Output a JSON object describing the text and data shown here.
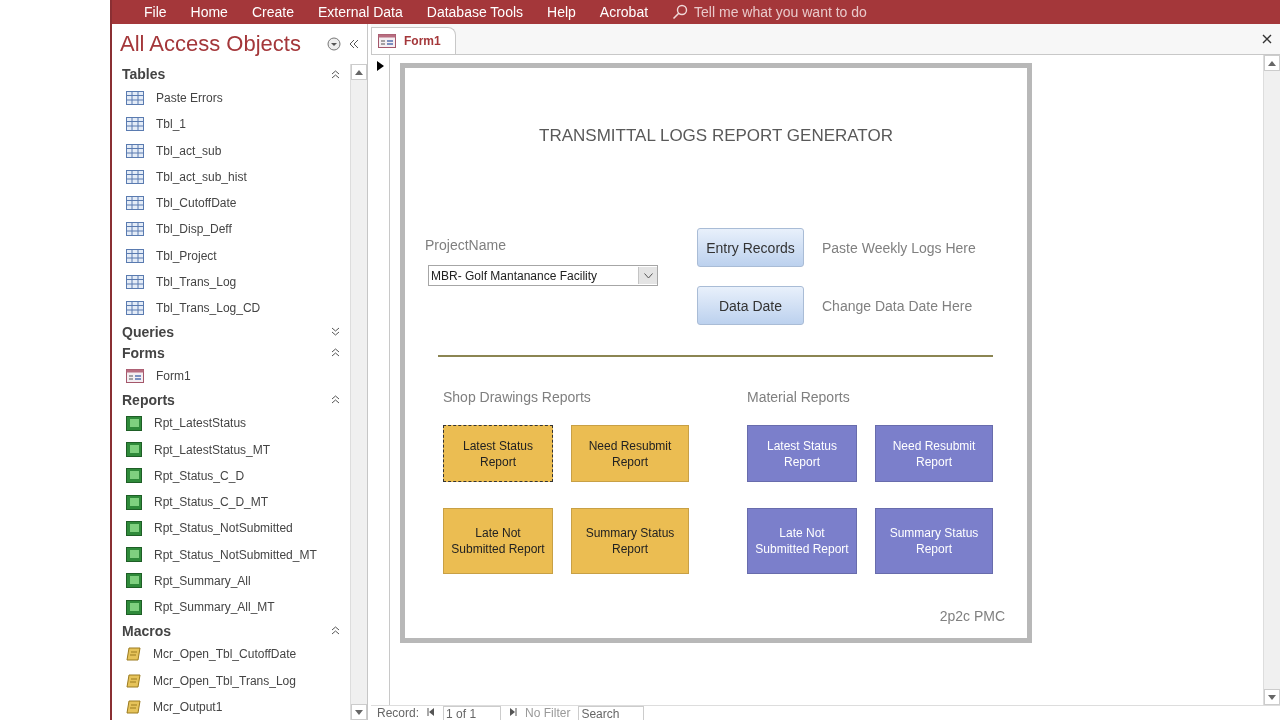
{
  "ribbon": {
    "tabs": [
      {
        "label": "File"
      },
      {
        "label": "Home"
      },
      {
        "label": "Create"
      },
      {
        "label": "External Data"
      },
      {
        "label": "Database Tools"
      },
      {
        "label": "Help"
      },
      {
        "label": "Acrobat"
      }
    ],
    "search": {
      "placeholder": "Tell me what you want to do"
    }
  },
  "nav_pane": {
    "title": "All Access Objects",
    "groups": [
      {
        "label": "Tables",
        "expanded": true,
        "items": [
          {
            "label": "Paste Errors",
            "kind": "table"
          },
          {
            "label": "Tbl_1",
            "kind": "table"
          },
          {
            "label": "Tbl_act_sub",
            "kind": "table"
          },
          {
            "label": "Tbl_act_sub_hist",
            "kind": "table"
          },
          {
            "label": "Tbl_CutoffDate",
            "kind": "table"
          },
          {
            "label": "Tbl_Disp_Deff",
            "kind": "table"
          },
          {
            "label": "Tbl_Project",
            "kind": "table"
          },
          {
            "label": "Tbl_Trans_Log",
            "kind": "table"
          },
          {
            "label": "Tbl_Trans_Log_CD",
            "kind": "table"
          }
        ]
      },
      {
        "label": "Queries",
        "expanded": false
      },
      {
        "label": "Forms",
        "expanded": true,
        "items": [
          {
            "label": "Form1",
            "kind": "form"
          }
        ]
      },
      {
        "label": "Reports",
        "expanded": true,
        "items": [
          {
            "label": "Rpt_LatestStatus",
            "kind": "report"
          },
          {
            "label": "Rpt_LatestStatus_MT",
            "kind": "report"
          },
          {
            "label": "Rpt_Status_C_D",
            "kind": "report"
          },
          {
            "label": "Rpt_Status_C_D_MT",
            "kind": "report"
          },
          {
            "label": "Rpt_Status_NotSubmitted",
            "kind": "report"
          },
          {
            "label": "Rpt_Status_NotSubmitted_MT",
            "kind": "report"
          },
          {
            "label": "Rpt_Summary_All",
            "kind": "report"
          },
          {
            "label": "Rpt_Summary_All_MT",
            "kind": "report"
          }
        ]
      },
      {
        "label": "Macros",
        "expanded": true,
        "items": [
          {
            "label": "Mcr_Open_Tbl_CutoffDate",
            "kind": "macro"
          },
          {
            "label": "Mcr_Open_Tbl_Trans_Log",
            "kind": "macro"
          },
          {
            "label": "Mcr_Output1",
            "kind": "macro"
          }
        ]
      }
    ]
  },
  "document_tabs": [
    {
      "label": "Form1",
      "selected": true
    }
  ],
  "form": {
    "title": "TRANSMITTAL LOGS REPORT GENERATOR",
    "project": {
      "label": "ProjectName",
      "value": "MBR- Golf Mantanance Facility"
    },
    "actions": [
      {
        "button": "Entry Records",
        "hint": "Paste Weekly Logs Here"
      },
      {
        "button": "Data Date",
        "hint": "Change Data Date Here"
      }
    ],
    "report_groups": [
      {
        "title": "Shop Drawings Reports",
        "color": "#ebbd52",
        "buttons": [
          {
            "label": "Latest Status Report",
            "focused": true
          },
          {
            "label": "Need Resubmit Report",
            "focused": false
          },
          {
            "label": "Late Not Submitted Report",
            "focused": false
          },
          {
            "label": "Summary Status Report",
            "focused": false
          }
        ]
      },
      {
        "title": "Material Reports",
        "color": "#7b7fcb",
        "buttons": [
          {
            "label": "Latest Status Report",
            "focused": false
          },
          {
            "label": "Need Resubmit Report",
            "focused": false
          },
          {
            "label": "Late Not Submitted Report",
            "focused": false
          },
          {
            "label": "Summary Status Report",
            "focused": false
          }
        ]
      }
    ],
    "footer": "2p2c PMC"
  },
  "record_bar": {
    "label": "Record:",
    "position": "1 of 1",
    "filter": "No Filter",
    "search": "Search"
  }
}
